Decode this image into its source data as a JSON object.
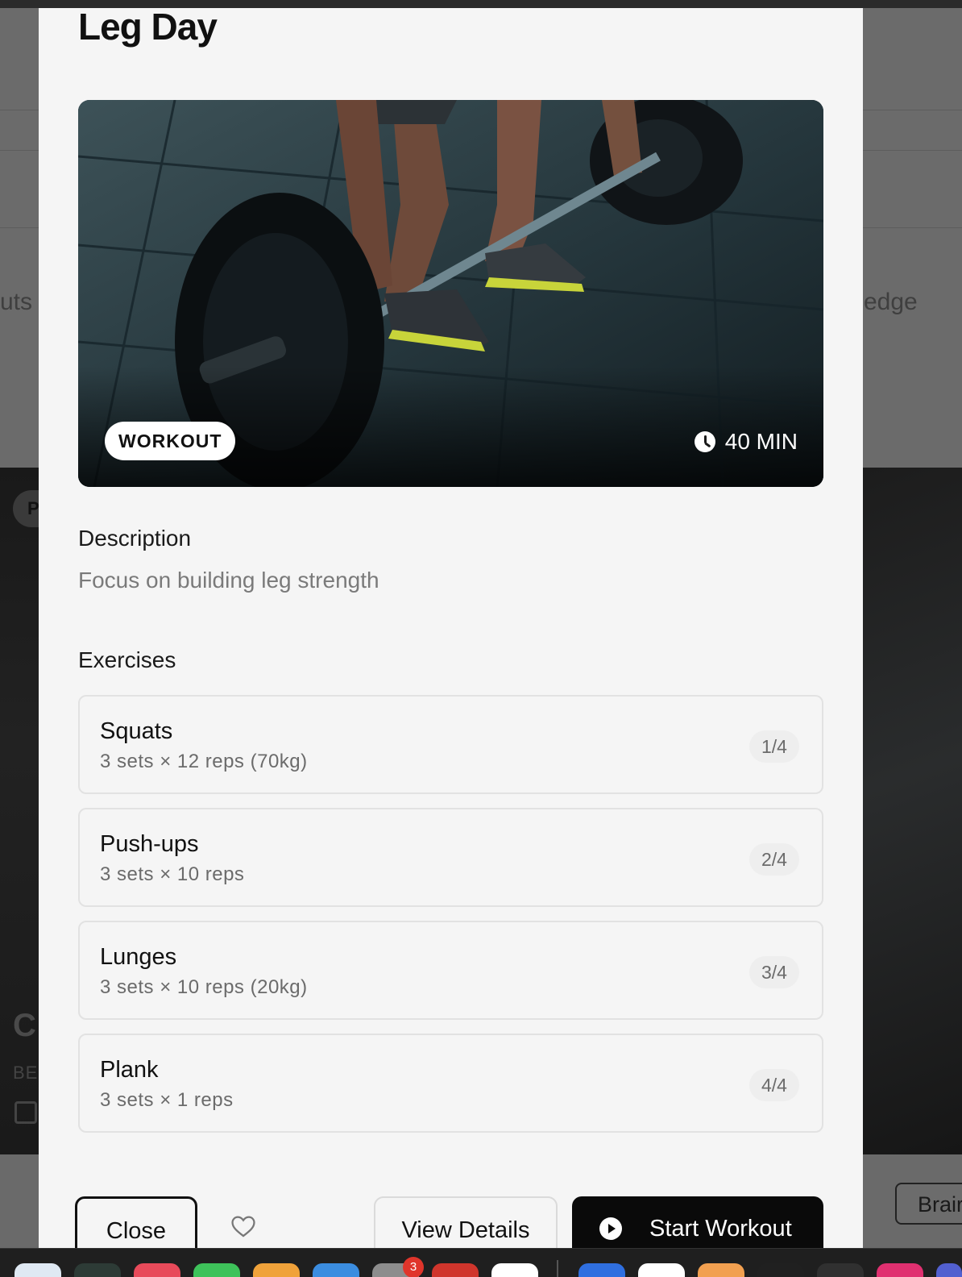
{
  "background": {
    "left_text": "uts",
    "right_text": "edge",
    "chip_text": "P",
    "big_text": "C",
    "small_text": "BE",
    "tooltip_text": "Brair"
  },
  "modal": {
    "title": "Leg Day",
    "hero": {
      "tag": "WORKOUT",
      "duration": "40 MIN"
    },
    "description": {
      "label": "Description",
      "text": "Focus on building leg strength"
    },
    "exercises": {
      "label": "Exercises",
      "items": [
        {
          "name": "Squats",
          "detail": "3 sets × 12 reps (70kg)",
          "position": "1/4"
        },
        {
          "name": "Push-ups",
          "detail": "3 sets × 10 reps",
          "position": "2/4"
        },
        {
          "name": "Lunges",
          "detail": "3 sets × 10 reps (20kg)",
          "position": "3/4"
        },
        {
          "name": "Plank",
          "detail": "3 sets × 1 reps",
          "position": "4/4"
        }
      ]
    },
    "actions": {
      "close_label": "Close",
      "view_details_label": "View Details",
      "start_label": "Start Workout"
    }
  },
  "dock": {
    "badge_count": "3",
    "icons": [
      "finder-icon",
      "terminal-icon",
      "music-icon",
      "numbers-icon",
      "pages-icon",
      "xcode-icon",
      "settings-icon",
      "app-icon",
      "shortcuts-icon",
      "browser-icon",
      "slack-icon",
      "app-icon",
      "terminal-icon",
      "monitor-icon",
      "jetbrains-icon",
      "app-icon"
    ],
    "colors": [
      "#dfe9f3",
      "#2d3b36",
      "#e84a5a",
      "#3ec25a",
      "#f0a23a",
      "#3b8de0",
      "#8d8d8d",
      "#d0352c",
      "#ffffff",
      "#2f6fe0",
      "#ffffff",
      "#f2a050",
      "#202020",
      "#303030",
      "#e03070",
      "#5260d0"
    ]
  }
}
